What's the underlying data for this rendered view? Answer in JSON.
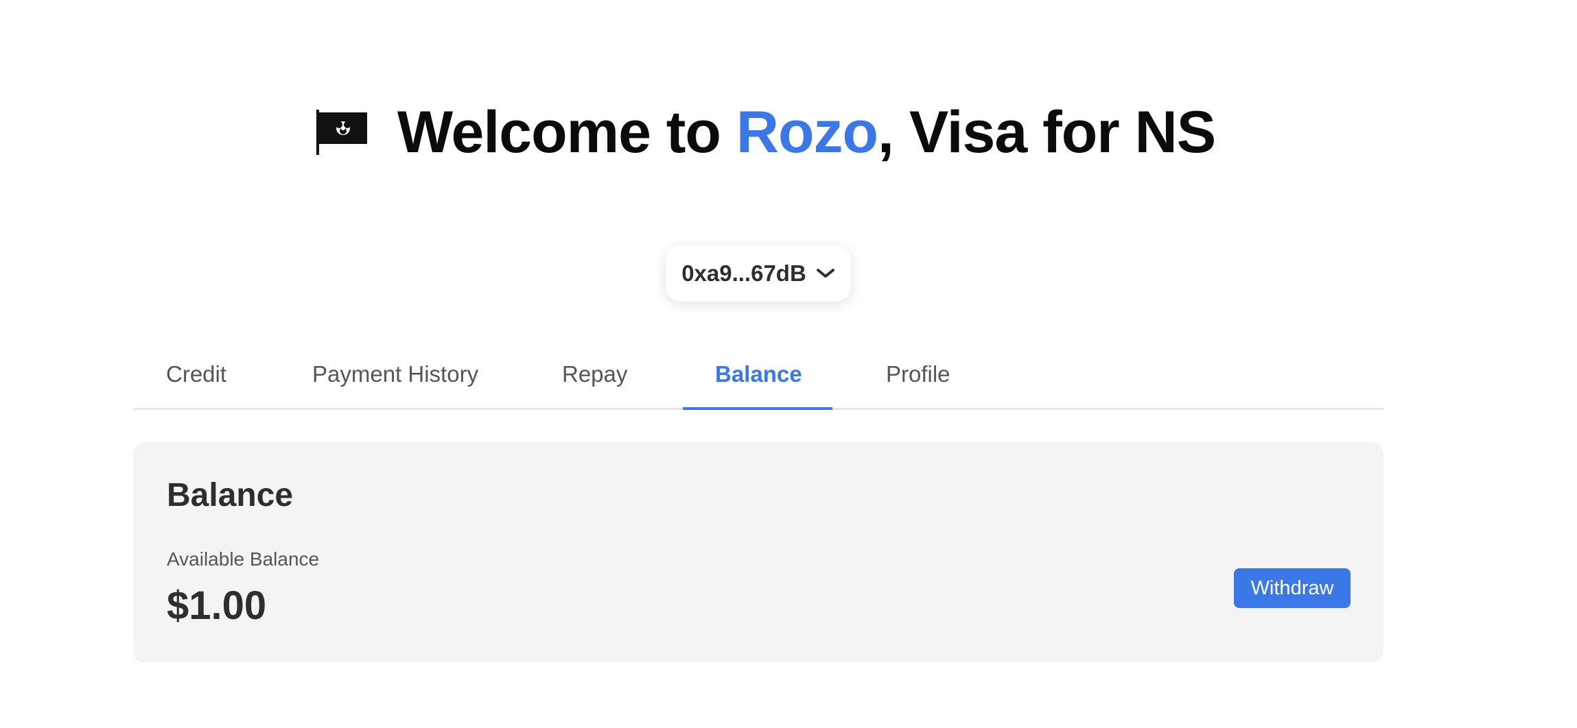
{
  "header": {
    "title_prefix": "Welcome to ",
    "title_brand": "Rozo",
    "title_suffix": ", Visa for NS",
    "flag_icon": "flag-icon",
    "brand_color": "#3b78e7"
  },
  "wallet": {
    "address": "0xa9...67dB",
    "dropdown_icon": "chevron-down-icon"
  },
  "tabs": [
    {
      "label": "Credit",
      "active": false
    },
    {
      "label": "Payment History",
      "active": false
    },
    {
      "label": "Repay",
      "active": false
    },
    {
      "label": "Balance",
      "active": true
    },
    {
      "label": "Profile",
      "active": false
    }
  ],
  "balance_card": {
    "heading": "Balance",
    "available_label": "Available Balance",
    "amount": "$1.00",
    "withdraw_label": "Withdraw"
  },
  "colors": {
    "accent": "#3b78e7",
    "card_background": "#f4f4f4",
    "tab_inactive": "#555555"
  }
}
